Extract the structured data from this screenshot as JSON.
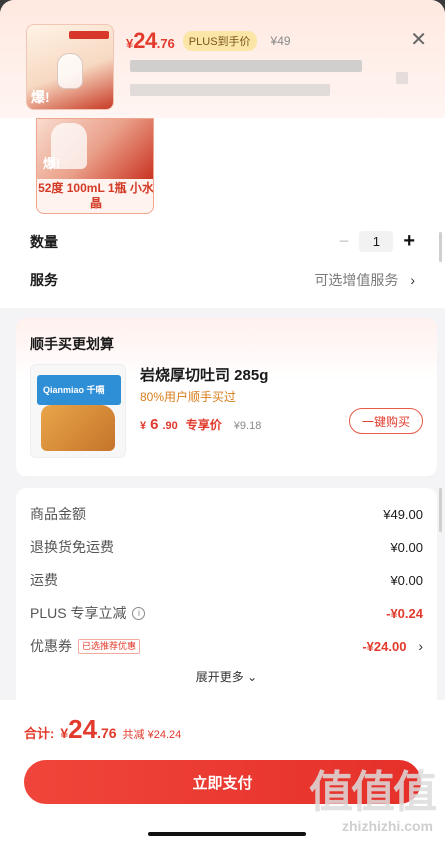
{
  "header": {
    "price_currency": "¥",
    "price_int": "24",
    "price_dec": ".76",
    "plus_badge": "PLUS到手价",
    "original_price": "¥49",
    "close_icon": "close-icon"
  },
  "variant": {
    "label": "52度 100mL 1瓶 小水晶",
    "burst_text": "爆!"
  },
  "quantity": {
    "label": "数量",
    "value": "1"
  },
  "service": {
    "label": "服务",
    "value": "可选增值服务"
  },
  "addon": {
    "title": "顺手买更划算",
    "product_name": "岩烧厚切吐司 285g",
    "product_sub": "80%用户顺手买过",
    "price_currency": "¥",
    "price_int": "6",
    "price_dec": ".90",
    "price_tag": "专享价",
    "original_price": "¥9.18",
    "buy_button": "一键购买",
    "brand_text": "Qianmiao 千嗝"
  },
  "details": {
    "rows": [
      {
        "label": "商品金额",
        "value": "¥49.00"
      },
      {
        "label": "退换货免运费",
        "value": "¥0.00"
      },
      {
        "label": "运费",
        "value": "¥0.00"
      },
      {
        "label": "PLUS 专享立减",
        "value": "-¥0.24"
      },
      {
        "label": "优惠券",
        "badge": "已选推荐优惠",
        "value": "-¥24.00"
      }
    ],
    "expand": "展开更多"
  },
  "footer": {
    "total_label": "合计:",
    "total_currency": "¥",
    "total_int": "24",
    "total_dec": ".76",
    "saved": "共减 ¥24.24",
    "pay_button": "立即支付"
  },
  "watermark": {
    "text": "值值值",
    "url": "zhizhizhi.com"
  }
}
